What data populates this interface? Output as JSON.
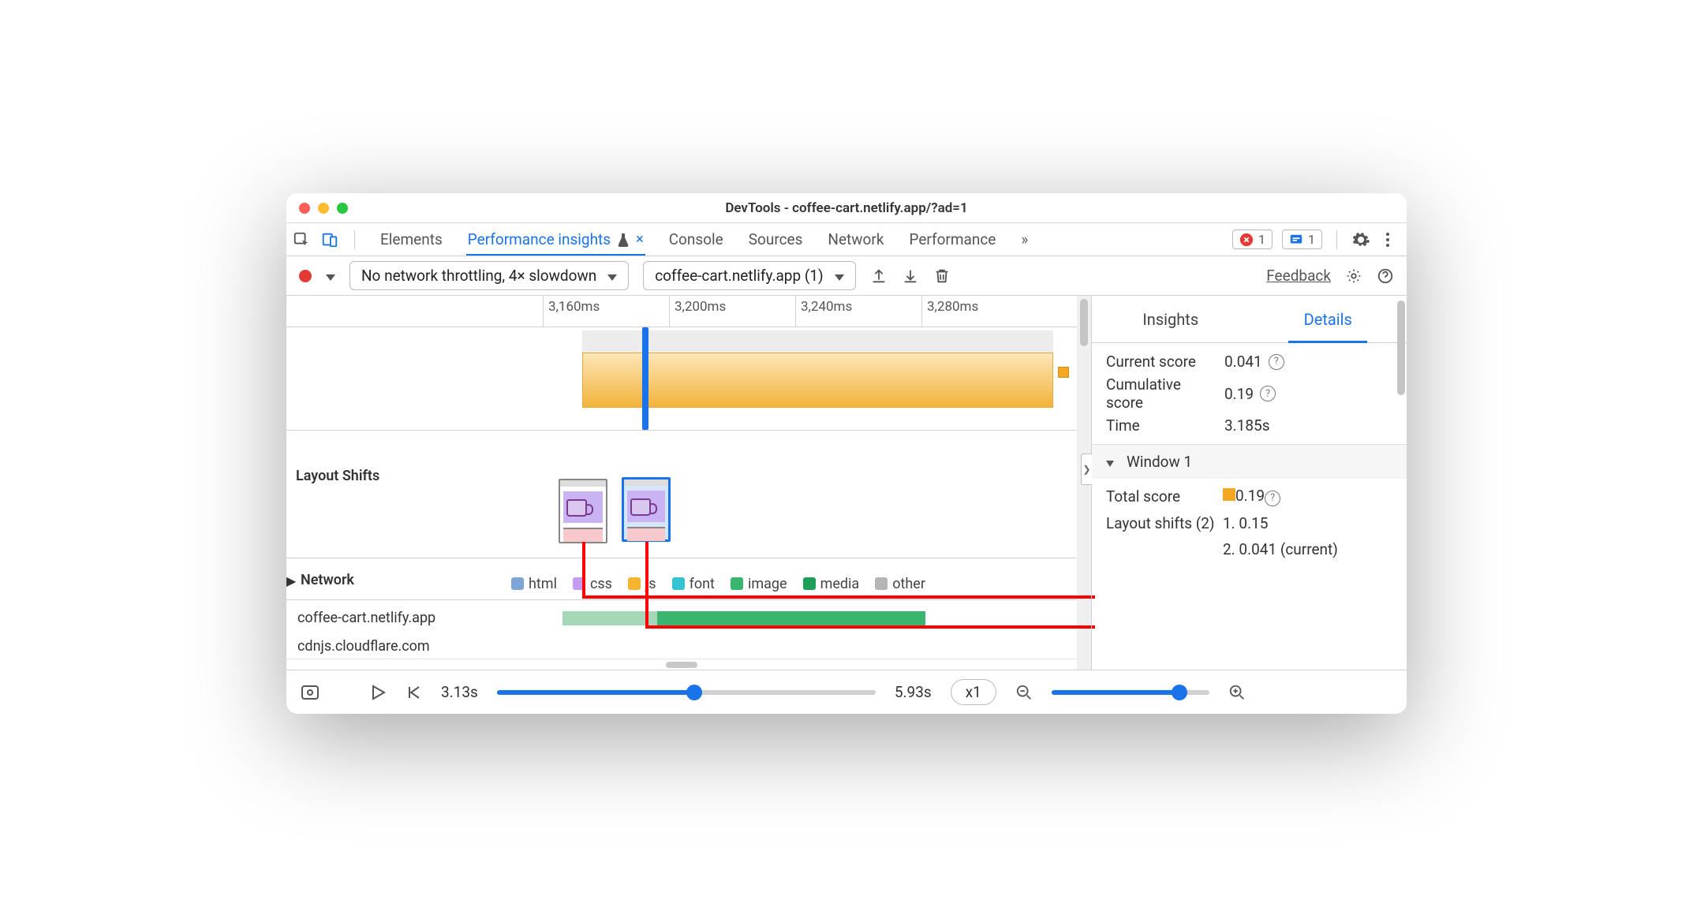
{
  "window": {
    "title": "DevTools - coffee-cart.netlify.app/?ad=1"
  },
  "tabs": {
    "items": [
      "Elements",
      "Performance insights",
      "Console",
      "Sources",
      "Network",
      "Performance"
    ],
    "active_index": 1,
    "experiment_icon": "flask-icon",
    "close_icon": "close-icon",
    "overflow": "»",
    "error_badge": "1",
    "message_badge": "1"
  },
  "toolbar": {
    "throttling": "No network throttling, 4× slowdown",
    "recording": "coffee-cart.netlify.app (1)",
    "feedback": "Feedback"
  },
  "timeline": {
    "ticks": [
      "3,160ms",
      "3,200ms",
      "3,240ms",
      "3,280ms"
    ],
    "section_labels": {
      "layout_shifts": "Layout Shifts",
      "network": "Network"
    },
    "legend": {
      "html": "html",
      "css": "css",
      "js": "js",
      "font": "font",
      "image": "image",
      "media": "media",
      "other": "other"
    },
    "hosts": [
      "coffee-cart.netlify.app",
      "cdnjs.cloudflare.com"
    ]
  },
  "side": {
    "tabs": {
      "insights": "Insights",
      "details": "Details"
    },
    "current_score_label": "Current score",
    "current_score": "0.041",
    "cumulative_label": "Cumulative score",
    "cumulative": "0.19",
    "time_label": "Time",
    "time": "3.185s",
    "window_label": "Window 1",
    "total_score_label": "Total score",
    "total_score": "0.19",
    "ls_label": "Layout shifts (2)",
    "ls1": "1. 0.15",
    "ls2": "2. 0.041 (current)"
  },
  "bottom": {
    "start": "3.13s",
    "end": "5.93s",
    "speed": "x1"
  }
}
